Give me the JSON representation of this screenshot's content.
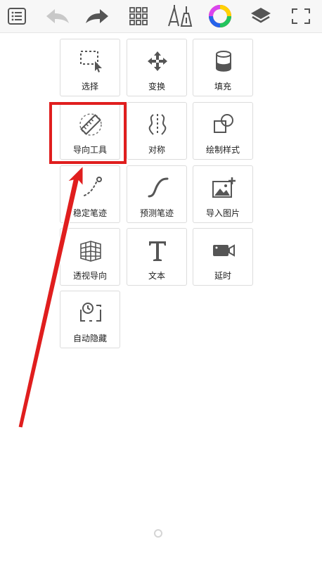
{
  "toolbar": {
    "buttons": [
      {
        "name": "menu-list-icon"
      },
      {
        "name": "undo-icon"
      },
      {
        "name": "redo-icon"
      },
      {
        "name": "grid-icon"
      },
      {
        "name": "brush-pen-icon"
      },
      {
        "name": "color-wheel-icon"
      },
      {
        "name": "layers-icon"
      },
      {
        "name": "fullscreen-icon"
      }
    ]
  },
  "tools": [
    {
      "label": "选择",
      "icon": "selection-icon"
    },
    {
      "label": "变换",
      "icon": "transform-icon"
    },
    {
      "label": "填充",
      "icon": "fill-bucket-icon"
    },
    {
      "label": "导向工具",
      "icon": "ruler-guide-icon"
    },
    {
      "label": "对称",
      "icon": "symmetry-icon"
    },
    {
      "label": "绘制样式",
      "icon": "draw-style-icon"
    },
    {
      "label": "稳定笔迹",
      "icon": "stabilizer-icon"
    },
    {
      "label": "预测笔迹",
      "icon": "predict-stroke-icon"
    },
    {
      "label": "导入图片",
      "icon": "import-image-icon"
    },
    {
      "label": "透视导向",
      "icon": "perspective-grid-icon"
    },
    {
      "label": "文本",
      "icon": "text-icon"
    },
    {
      "label": "延时",
      "icon": "timelapse-camera-icon"
    },
    {
      "label": "自动隐藏",
      "icon": "auto-hide-icon"
    }
  ],
  "colors": {
    "highlight": "#e01e1e",
    "arrow": "#e01e1e",
    "icon": "#444444",
    "toolbar_bg": "#f7f7f7"
  }
}
